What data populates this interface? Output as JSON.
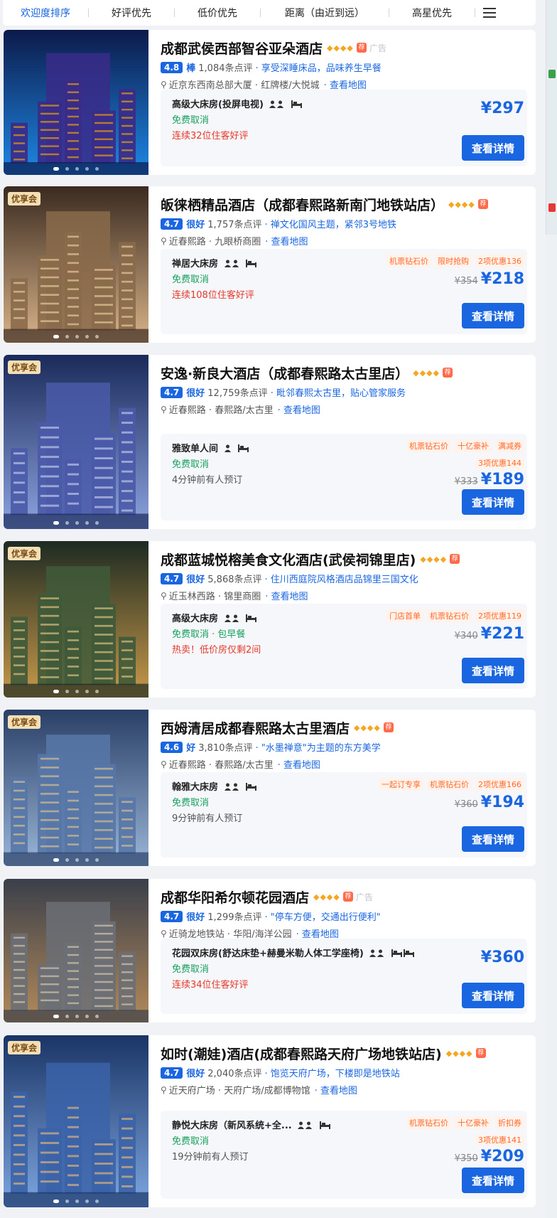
{
  "sort_bar": {
    "items": [
      "欢迎度排序",
      "好评优先",
      "低价优先",
      "距离（由近到远）",
      "高星优先"
    ],
    "active_index": 0
  },
  "colors": {
    "accent": "#1a66e0",
    "price": "#1a66e0",
    "cancel": "#17a05d",
    "alert": "#e5392c",
    "tag": "#ff6a2b"
  },
  "view_button_label": "查看详情",
  "map_link_label": "查看地图",
  "hotels": [
    {
      "name": "成都武侯西部智谷亚朵酒店",
      "stars": "◆◆◆◆",
      "ad": "广告",
      "vip_badge": "",
      "score": "4.8",
      "level": "棒",
      "reviews": "1,084条点评",
      "tagline": "享受深睡床品，品味养生早餐",
      "location": "近京东西南总部大厦 · 红牌楼/大悦城",
      "room": "高级大床房(投屏电视)",
      "cancel": "免费取消",
      "note": "连续32位住客好评",
      "note_color": "red",
      "tags": [],
      "tags2": "",
      "orig_price": "",
      "price": "¥297"
    },
    {
      "name": "皈徕栖精品酒店（成都春熙路新南门地铁站店）",
      "stars": "◆◆◆◆",
      "ad": "",
      "vip_badge": "优享会",
      "score": "4.7",
      "level": "很好",
      "reviews": "1,757条点评",
      "tagline": "禅文化国风主题，紧邻3号地铁",
      "location": "近春熙路 · 九眼桥商圈",
      "room": "禅居大床房",
      "cancel": "免费取消",
      "note": "连续108位住客好评",
      "note_color": "red",
      "tags": [
        "机票钻石价",
        "限时抢购",
        "2项优惠136"
      ],
      "tags2": "",
      "orig_price": "¥354",
      "price": "¥218"
    },
    {
      "name": "安逸·新良大酒店（成都春熙路太古里店）",
      "stars": "◆◆◆◆",
      "ad": "",
      "vip_badge": "优享会",
      "score": "4.7",
      "level": "很好",
      "reviews": "12,759条点评",
      "tagline": "毗邻春熙太古里，贴心管家服务",
      "location": "近春熙路 · 春熙路/太古里",
      "room": "雅致单人间",
      "cancel": "免费取消",
      "note": "4分钟前有人预订",
      "note_color": "gray",
      "tags": [
        "机票钻石价",
        "十亿豪补",
        "满减券"
      ],
      "tags2": "3项优惠144",
      "orig_price": "¥333",
      "price": "¥189"
    },
    {
      "name": "成都蓝城悦榕美食文化酒店(武侯祠锦里店)",
      "stars": "◆◆◆◆",
      "ad": "",
      "vip_badge": "优享会",
      "score": "4.7",
      "level": "很好",
      "reviews": "5,868条点评",
      "tagline": "住川西庭院风格酒店品锦里三国文化",
      "location": "近玉林西路 · 锦里商圈",
      "room": "高级大床房",
      "cancel": "免费取消 · 包早餐",
      "note": "热卖！低价房仅剩2间",
      "note_color": "red",
      "tags": [
        "门店首单",
        "机票钻石价",
        "2项优惠119"
      ],
      "tags2": "",
      "orig_price": "¥340",
      "price": "¥221"
    },
    {
      "name": "西姆清居成都春熙路太古里酒店",
      "stars": "◆◆◆◆",
      "ad": "",
      "vip_badge": "优享会",
      "score": "4.6",
      "level": "好",
      "reviews": "3,810条点评",
      "tagline": "\"水墨禅意\"为主题的东方美学",
      "location": "近春熙路 · 春熙路/太古里",
      "room": "翰雅大床房",
      "cancel": "免费取消",
      "note": "9分钟前有人预订",
      "note_color": "gray",
      "tags": [
        "一起订专享",
        "机票钻石价",
        "2项优惠166"
      ],
      "tags2": "",
      "orig_price": "¥360",
      "price": "¥194"
    },
    {
      "name": "成都华阳希尔顿花园酒店",
      "stars": "◆◆◆◆",
      "ad": "广告",
      "vip_badge": "",
      "score": "4.7",
      "level": "很好",
      "reviews": "1,299条点评",
      "tagline": "\"停车方便，交通出行便利\"",
      "location": "近骑龙地铁站 · 华阳/海洋公园",
      "room": "花园双床房(舒达床垫+赫曼米勒人体工学座椅)",
      "cancel": "免费取消",
      "note": "连续34位住客好评",
      "note_color": "red",
      "tags": [],
      "tags2": "",
      "orig_price": "",
      "price": "¥360"
    },
    {
      "name": "如时(潮娃)酒店(成都春熙路天府广场地铁站店)",
      "stars": "◆◆◆◆",
      "ad": "",
      "vip_badge": "优享会",
      "score": "4.7",
      "level": "很好",
      "reviews": "2,040条点评",
      "tagline": "饱览天府广场，下楼即是地铁站",
      "location": "近天府广场 · 天府广场/成都博物馆",
      "room": "静悦大床房（新风系统+全...",
      "cancel": "免费取消",
      "note": "19分钟前有人预订",
      "note_color": "gray",
      "tags": [
        "机票钻石价",
        "十亿豪补",
        "折扣券"
      ],
      "tags2": "3项优惠141",
      "orig_price": "¥350",
      "price": "¥209"
    }
  ]
}
